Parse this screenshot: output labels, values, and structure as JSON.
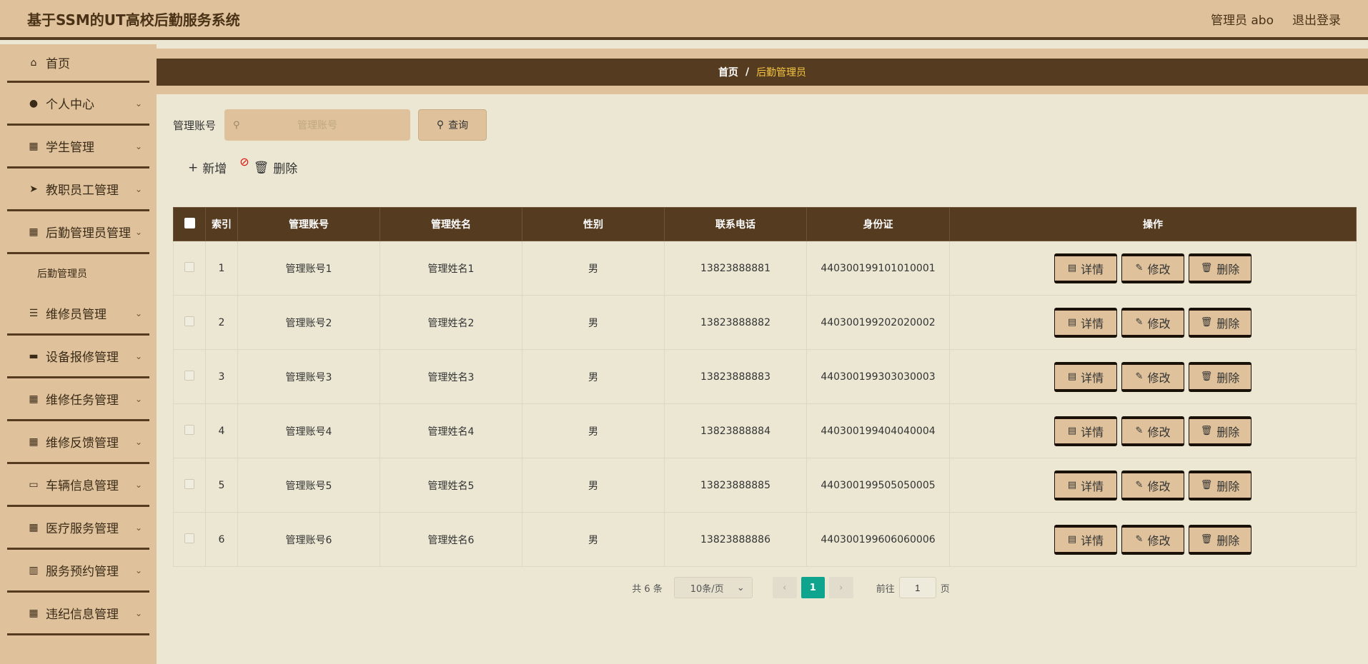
{
  "header": {
    "title": "基于SSM的UT高校后勤服务系统",
    "user": "管理员 abo",
    "logout": "退出登录"
  },
  "sidebar": {
    "items": [
      {
        "label": "首页",
        "icon": "home-icon"
      },
      {
        "label": "个人中心",
        "icon": "user-icon"
      },
      {
        "label": "学生管理",
        "icon": "grid-icon"
      },
      {
        "label": "教职员工管理",
        "icon": "send-icon"
      },
      {
        "label": "后勤管理员管理",
        "icon": "grid-icon"
      },
      {
        "label": "维修员管理",
        "icon": "sliders-icon"
      },
      {
        "label": "设备报修管理",
        "icon": "message-icon"
      },
      {
        "label": "维修任务管理",
        "icon": "grid-icon"
      },
      {
        "label": "维修反馈管理",
        "icon": "grid-icon"
      },
      {
        "label": "车辆信息管理",
        "icon": "monitor-icon"
      },
      {
        "label": "医疗服务管理",
        "icon": "grid-icon"
      },
      {
        "label": "服务预约管理",
        "icon": "book-icon"
      },
      {
        "label": "违纪信息管理",
        "icon": "grid-icon"
      }
    ],
    "submenu": "后勤管理员"
  },
  "breadcrumb": {
    "home": "首页",
    "sep": "/",
    "current": "后勤管理员"
  },
  "search": {
    "label": "管理账号",
    "placeholder": "管理账号",
    "value": "",
    "button": "查询"
  },
  "actions": {
    "add": "新增",
    "delete": "删除"
  },
  "table": {
    "columns": [
      "索引",
      "管理账号",
      "管理姓名",
      "性别",
      "联系电话",
      "身份证",
      "操作"
    ],
    "rows": [
      {
        "index": "1",
        "account": "管理账号1",
        "name": "管理姓名1",
        "gender": "男",
        "phone": "13823888881",
        "id_card": "440300199101010001"
      },
      {
        "index": "2",
        "account": "管理账号2",
        "name": "管理姓名2",
        "gender": "男",
        "phone": "13823888882",
        "id_card": "440300199202020002"
      },
      {
        "index": "3",
        "account": "管理账号3",
        "name": "管理姓名3",
        "gender": "男",
        "phone": "13823888883",
        "id_card": "440300199303030003"
      },
      {
        "index": "4",
        "account": "管理账号4",
        "name": "管理姓名4",
        "gender": "男",
        "phone": "13823888884",
        "id_card": "440300199404040004"
      },
      {
        "index": "5",
        "account": "管理账号5",
        "name": "管理姓名5",
        "gender": "男",
        "phone": "13823888885",
        "id_card": "440300199505050005"
      },
      {
        "index": "6",
        "account": "管理账号6",
        "name": "管理姓名6",
        "gender": "男",
        "phone": "13823888886",
        "id_card": "440300199606060006"
      }
    ],
    "ops": {
      "detail": "详情",
      "edit": "修改",
      "delete": "删除"
    }
  },
  "pagination": {
    "total": "共 6 条",
    "page_size": "10条/页",
    "current_page": "1",
    "goto_prefix": "前往",
    "goto_value": "1",
    "goto_suffix": "页"
  },
  "colors": {
    "header_bg": "#dfc29b",
    "dark_brown": "#553b20",
    "content_bg": "#ebe7d3",
    "active_page": "#0fa48d",
    "breadcrumb_current": "#f5c542"
  }
}
